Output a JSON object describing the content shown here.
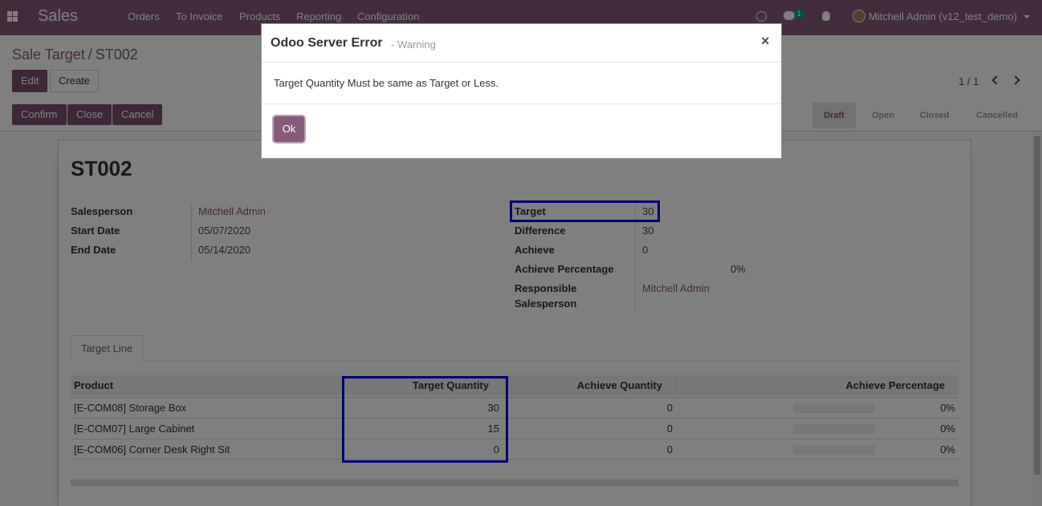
{
  "navbar": {
    "brand": "Sales",
    "menu": [
      "Orders",
      "To Invoice",
      "Products",
      "Reporting",
      "Configuration"
    ],
    "chat_count": "1",
    "user": "Mitchell Admin (v12_test_demo)",
    "icons": [
      "apps-icon",
      "clock-icon",
      "chat-icon",
      "bug-icon"
    ]
  },
  "control_panel": {
    "breadcrumb_parent": "Sale Target",
    "breadcrumb_separator": "/",
    "breadcrumb_current": "ST002",
    "edit_label": "Edit",
    "create_label": "Create",
    "pager": "1 / 1",
    "actions": [
      "Confirm",
      "Close",
      "Cancel"
    ],
    "statuses": [
      "Draft",
      "Open",
      "Closed",
      "Cancelled"
    ],
    "active_status": "Draft"
  },
  "form": {
    "title": "ST002",
    "left": [
      {
        "label": "Salesperson",
        "value": "Mitchell Admin",
        "link": true
      },
      {
        "label": "Start Date",
        "value": "05/07/2020",
        "link": false
      },
      {
        "label": "End Date",
        "value": "05/14/2020",
        "link": false
      }
    ],
    "right": {
      "target_label": "Target",
      "target_value": "30",
      "difference_label": "Difference",
      "difference_value": "30",
      "achieve_label": "Achieve",
      "achieve_value": "0",
      "achieve_pct_label": "Achieve Percentage",
      "achieve_pct_value": "0%",
      "responsible_label_1": "Responsible",
      "responsible_label_2": "Salesperson",
      "responsible_value": "Mitchell Admin"
    },
    "tab_label": "Target Line",
    "table": {
      "headers": [
        "Product",
        "Target Quantity",
        "Achieve Quantity",
        "Achieve Percentage"
      ],
      "rows": [
        {
          "product": "[E-COM08] Storage Box",
          "target_qty": "30",
          "achieve_qty": "0",
          "achieve_pct": "0%"
        },
        {
          "product": "[E-COM07] Large Cabinet",
          "target_qty": "15",
          "achieve_qty": "0",
          "achieve_pct": "0%"
        },
        {
          "product": "[E-COM06] Corner Desk Right Sit",
          "target_qty": "0",
          "achieve_qty": "0",
          "achieve_pct": "0%"
        }
      ]
    }
  },
  "dialog": {
    "title": "Odoo Server Error",
    "subtitle": "- Warning",
    "close_glyph": "×",
    "message": "Target Quantity Must be same as Target or Less.",
    "ok_label": "Ok"
  },
  "colors": {
    "brand": "#875a7b",
    "highlight": "#0000ee"
  }
}
